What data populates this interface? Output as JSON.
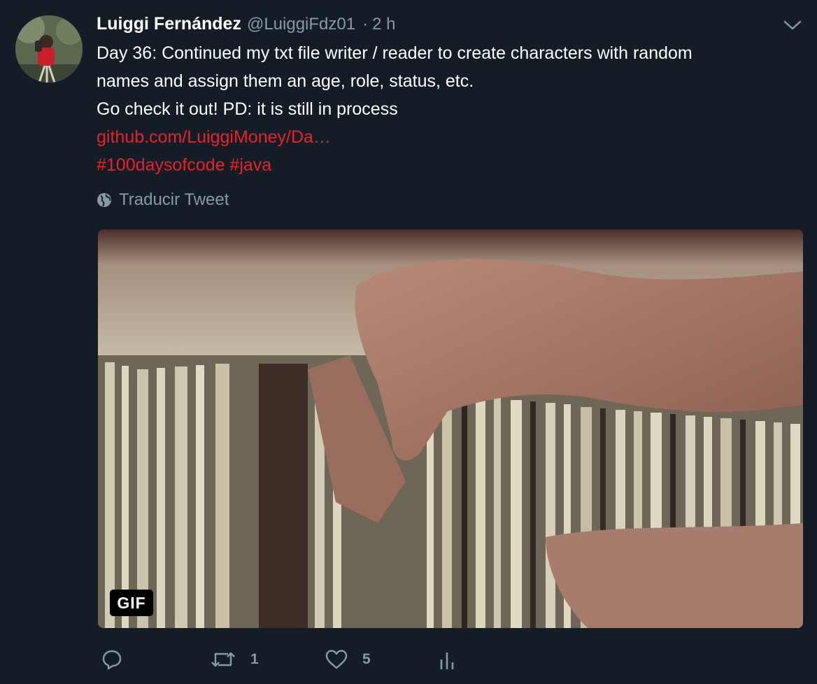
{
  "tweet": {
    "author": {
      "display_name": "Luiggi Fernández",
      "handle": "@LuiggiFdz01",
      "separator": "·",
      "time": "2 h"
    },
    "text_lines": [
      "Day 36: Continued my txt file writer / reader to create characters with random",
      "names and assign them an age, role, status, etc.",
      "Go check it out! PD: it is still in process"
    ],
    "link": "github.com/LuiggiMoney/Da…",
    "hashtags": "#100daysofcode #java",
    "translate_label": "Traducir Tweet",
    "media": {
      "badge": "GIF"
    },
    "actions": {
      "reply_count": "",
      "retweet_count": "1",
      "like_count": "5"
    }
  },
  "colors": {
    "background": "#141d26",
    "secondary_text": "#8899a6",
    "link": "#e8212a"
  },
  "icons": [
    "avatar",
    "chevron-down-icon",
    "globe-icon",
    "reply-icon",
    "retweet-icon",
    "like-icon",
    "analytics-icon"
  ]
}
